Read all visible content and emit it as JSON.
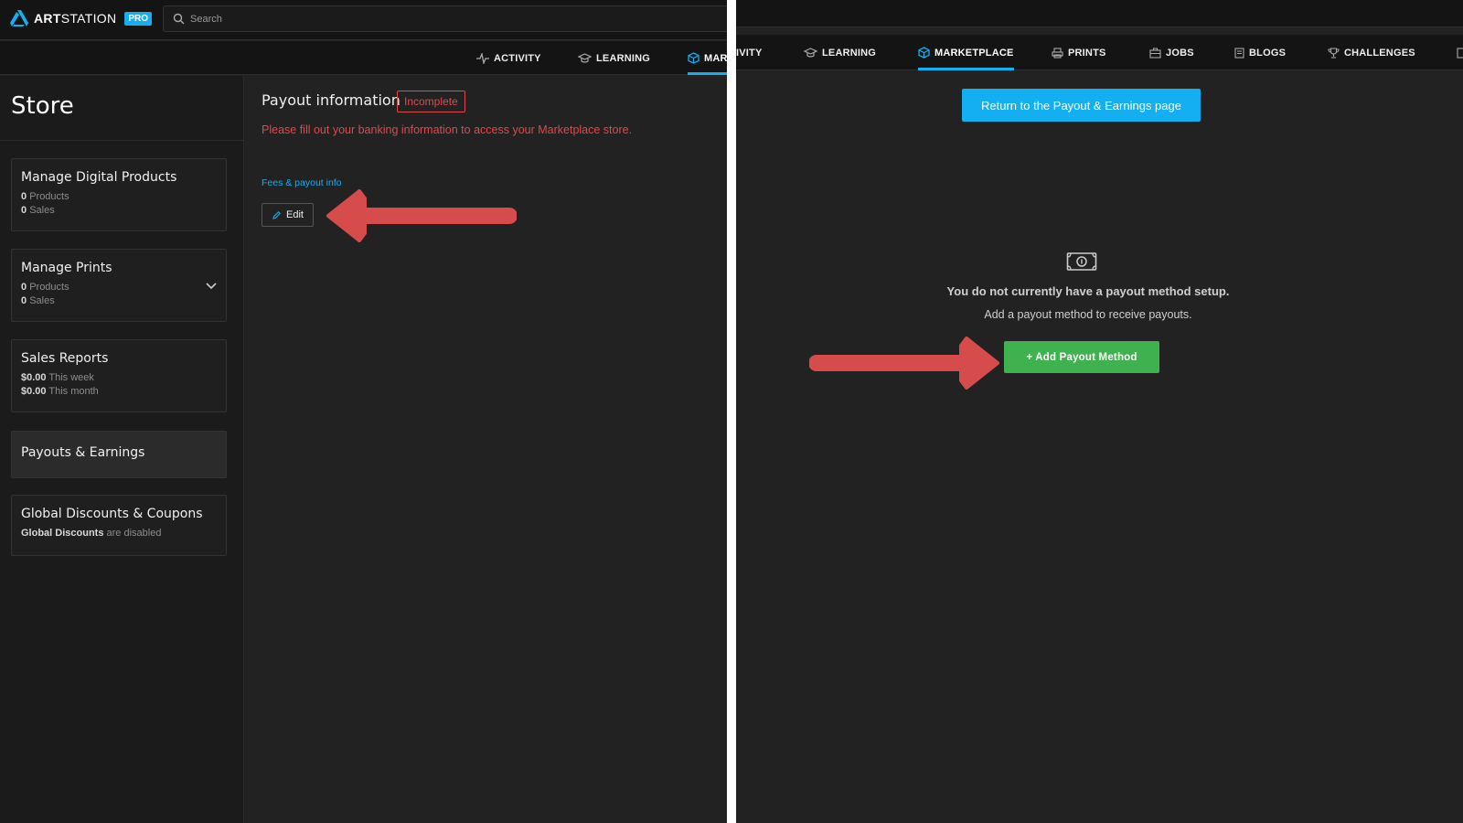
{
  "left": {
    "brand": {
      "name_bold": "ART",
      "name_thin": "STATION",
      "badge": "PRO"
    },
    "search": {
      "placeholder": "Search"
    },
    "nav": {
      "activity": "ACTIVITY",
      "learning": "LEARNING",
      "marketplace_partial": "MAR"
    },
    "sidebar": {
      "title": "Store",
      "cards": [
        {
          "title": "Manage Digital Products",
          "l1_num": "0",
          "l1_text": "Products",
          "l2_num": "0",
          "l2_text": "Sales"
        },
        {
          "title": "Manage Prints",
          "l1_num": "0",
          "l1_text": "Products",
          "l2_num": "0",
          "l2_text": "Sales"
        },
        {
          "title": "Sales Reports",
          "l1_num": "$0.00",
          "l1_text": "This week",
          "l2_num": "$0.00",
          "l2_text": "This month"
        },
        {
          "title": "Payouts & Earnings"
        },
        {
          "title": "Global Discounts & Coupons",
          "l1_num": "Global Discounts",
          "l1_text": "are disabled"
        }
      ]
    },
    "main": {
      "payout_title": "Payout information",
      "status_badge": "Incomplete",
      "warning": "Please fill out your banking information to access your Marketplace store.",
      "fees_link": "Fees & payout info",
      "edit_label": "Edit"
    }
  },
  "right": {
    "nav": {
      "activity_partial": "IVITY",
      "learning": "LEARNING",
      "marketplace": "MARKETPLACE",
      "prints": "PRINTS",
      "jobs": "JOBS",
      "blogs": "BLOGS",
      "challenges": "CHALLENGES"
    },
    "return_button": "Return to the Payout & Earnings page",
    "empty_title": "You do not currently have a payout method setup.",
    "empty_subtitle": "Add a payout method to receive payouts.",
    "add_button": "+ Add Payout Method"
  },
  "colors": {
    "accent_blue": "#13aff0",
    "alert_red": "#e0484d",
    "success_green": "#3fb24f",
    "annotation_arrow": "#d64b4b"
  },
  "icons": [
    "artstation-logo-icon",
    "search-icon",
    "activity-icon",
    "learning-icon",
    "marketplace-icon",
    "prints-icon",
    "jobs-icon",
    "blogs-icon",
    "challenges-icon",
    "pencil-icon",
    "chevron-down-icon",
    "money-icon"
  ]
}
